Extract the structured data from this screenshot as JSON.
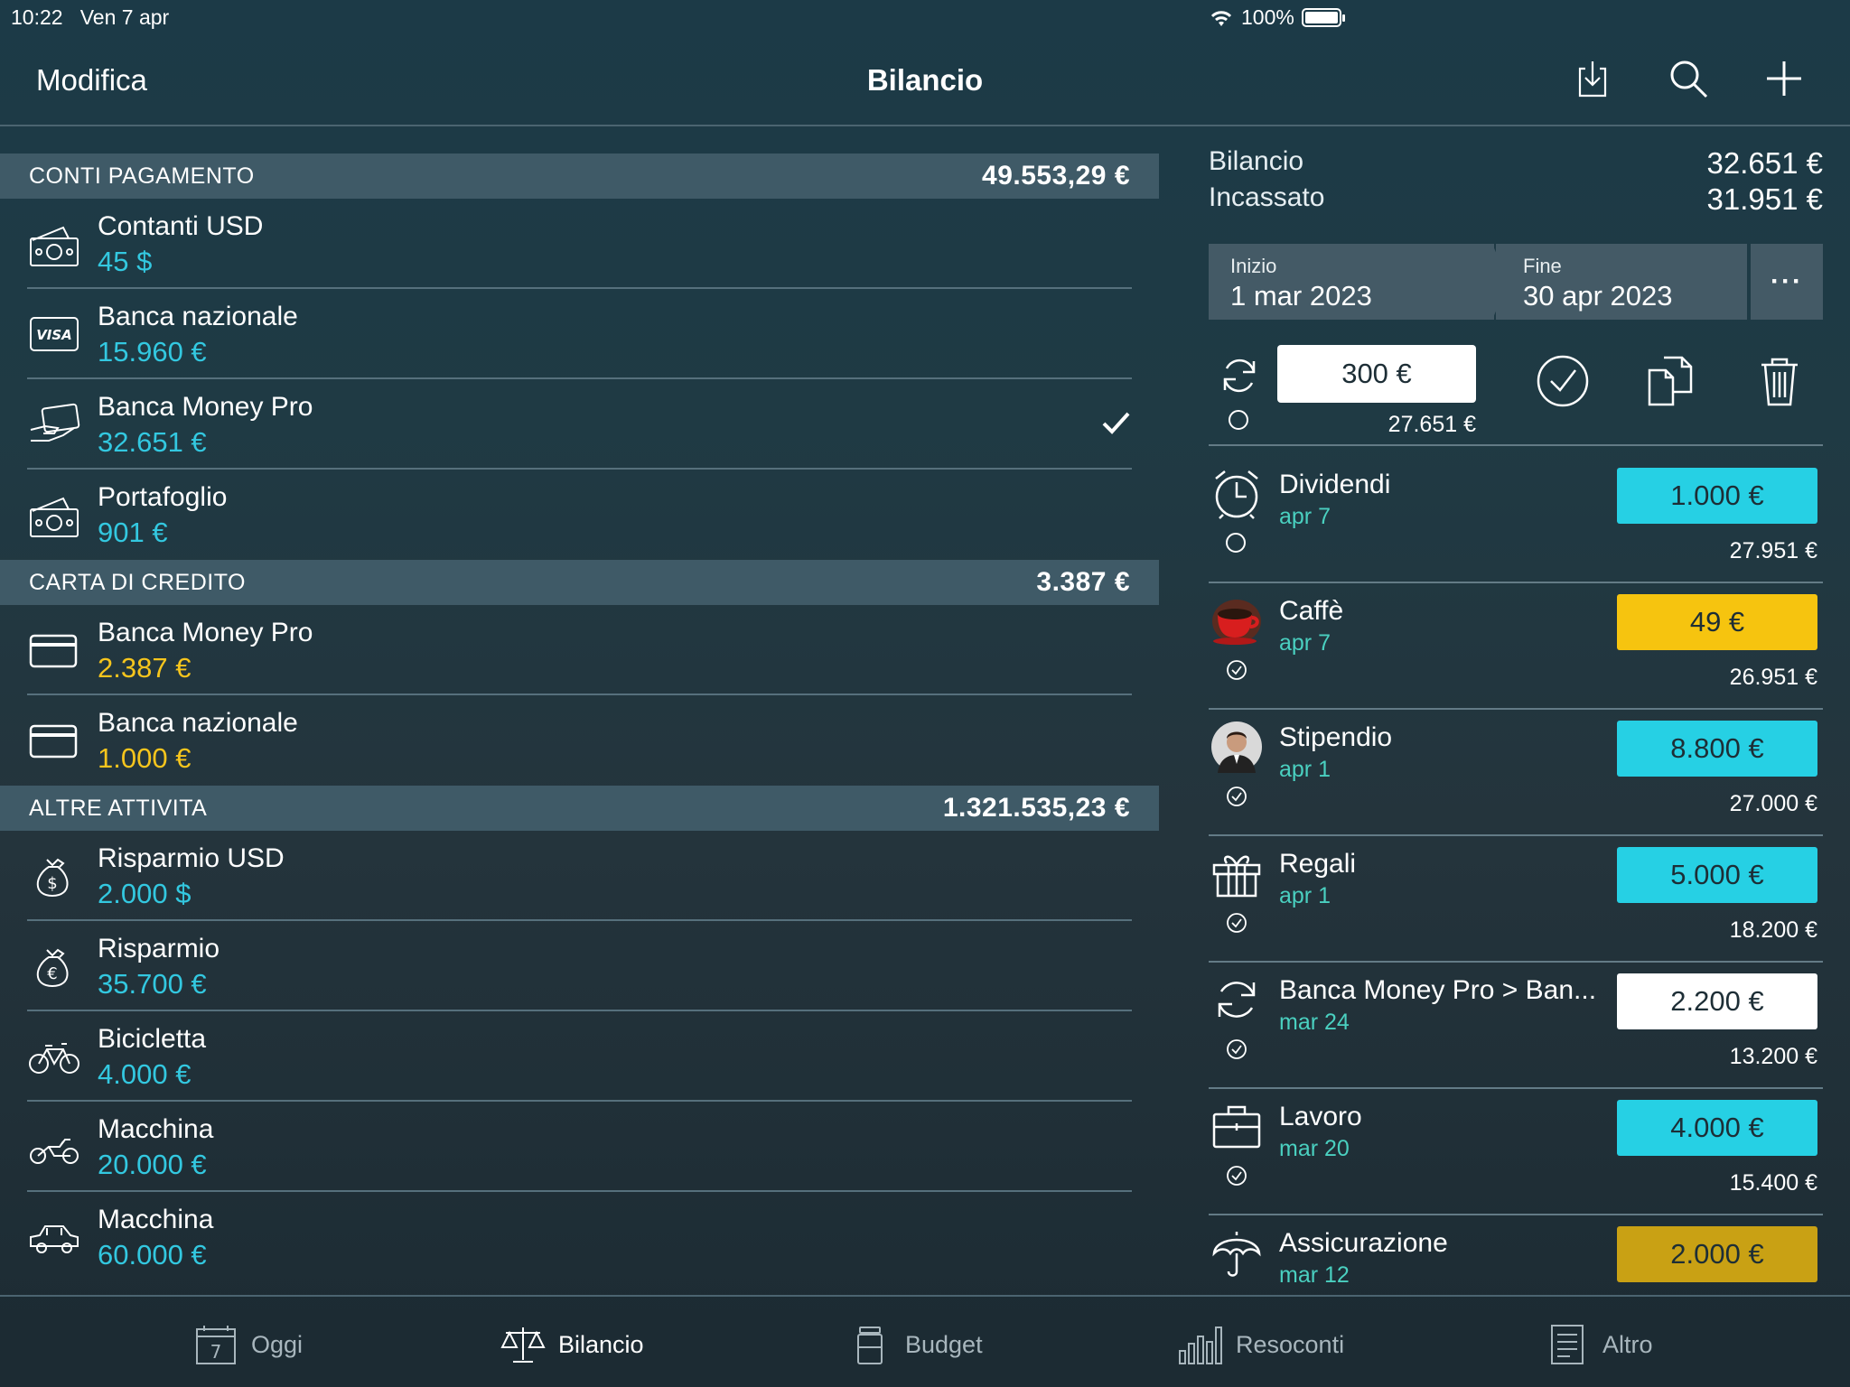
{
  "status": {
    "time": "10:22",
    "date": "Ven 7 apr",
    "battery": "100%"
  },
  "nav": {
    "edit": "Modifica",
    "title": "Bilancio"
  },
  "sections": [
    {
      "title": "CONTI PAGAMENTO",
      "total": "49.553,29 €",
      "accounts": [
        {
          "icon": "cash-icon",
          "name": "Contanti USD",
          "value": "45 $",
          "color": "cyan"
        },
        {
          "icon": "visa-card-icon",
          "name": "Banca nazionale",
          "value": "15.960 €",
          "color": "cyan"
        },
        {
          "icon": "card-in-hand-icon",
          "name": "Banca Money Pro",
          "value": "32.651 €",
          "color": "cyan",
          "selected": true
        },
        {
          "icon": "cash-icon",
          "name": "Portafoglio",
          "value": "901 €",
          "color": "cyan"
        }
      ]
    },
    {
      "title": "CARTA DI CREDITO",
      "total": "3.387 €",
      "accounts": [
        {
          "icon": "credit-card-icon",
          "name": "Banca Money Pro",
          "value": "2.387 €",
          "color": "yellow"
        },
        {
          "icon": "credit-card-icon",
          "name": "Banca nazionale",
          "value": "1.000 €",
          "color": "yellow"
        }
      ]
    },
    {
      "title": "ALTRE ATTIVITA",
      "total": "1.321.535,23 €",
      "accounts": [
        {
          "icon": "money-bag-dollar-icon",
          "name": "Risparmio USD",
          "value": "2.000 $",
          "color": "cyan"
        },
        {
          "icon": "money-bag-euro-icon",
          "name": "Risparmio",
          "value": "35.700 €",
          "color": "cyan"
        },
        {
          "icon": "bicycle-icon",
          "name": "Bicicletta",
          "value": "4.000 €",
          "color": "cyan"
        },
        {
          "icon": "motorcycle-icon",
          "name": "Macchina",
          "value": "20.000 €",
          "color": "cyan"
        },
        {
          "icon": "car-icon",
          "name": "Macchina",
          "value": "60.000 €",
          "color": "cyan"
        }
      ]
    }
  ],
  "summary": {
    "balance_label": "Bilancio",
    "balance": "32.651 €",
    "cashed_label": "Incassato",
    "cashed": "31.951 €"
  },
  "period": {
    "start_label": "Inizio",
    "start": "1 mar 2023",
    "end_label": "Fine",
    "end": "30 apr 2023",
    "more": "···"
  },
  "quick": {
    "amount": "300 €",
    "balance": "27.651 €"
  },
  "transactions": [
    {
      "icon": "alarm-clock-icon",
      "name": "Dividendi",
      "date": "apr 7",
      "amount": "1.000 €",
      "style": "cyan",
      "balance": "27.951 €",
      "status": "pending"
    },
    {
      "icon": "coffee-cup-icon",
      "name": "Caffè",
      "date": "apr 7",
      "amount": "49 €",
      "style": "yellowbg",
      "balance": "26.951 €",
      "status": "done"
    },
    {
      "icon": "person-avatar-icon",
      "name": "Stipendio",
      "date": "apr 1",
      "amount": "8.800 €",
      "style": "cyan",
      "balance": "27.000 €",
      "status": "done"
    },
    {
      "icon": "gift-icon",
      "name": "Regali",
      "date": "apr 1",
      "amount": "5.000 €",
      "style": "cyan",
      "balance": "18.200 €",
      "status": "done"
    },
    {
      "icon": "transfer-icon",
      "name": "Banca Money Pro > Ban...",
      "date": "mar 24",
      "amount": "2.200 €",
      "style": "white",
      "balance": "13.200 €",
      "status": "done"
    },
    {
      "icon": "briefcase-icon",
      "name": "Lavoro",
      "date": "mar 20",
      "amount": "4.000 €",
      "style": "cyan",
      "balance": "15.400 €",
      "status": "done"
    },
    {
      "icon": "umbrella-icon",
      "name": "Assicurazione",
      "date": "mar 12",
      "amount": "2.000 €",
      "style": "goldbg",
      "balance": "",
      "status": "none"
    }
  ],
  "tabs": [
    {
      "icon": "calendar-icon",
      "label": "Oggi",
      "day": "7",
      "active": false
    },
    {
      "icon": "balance-scale-icon",
      "label": "Bilancio",
      "active": true
    },
    {
      "icon": "budget-jar-icon",
      "label": "Budget",
      "active": false
    },
    {
      "icon": "bar-chart-icon",
      "label": "Resoconti",
      "active": false
    },
    {
      "icon": "document-list-icon",
      "label": "Altro",
      "active": false
    }
  ]
}
